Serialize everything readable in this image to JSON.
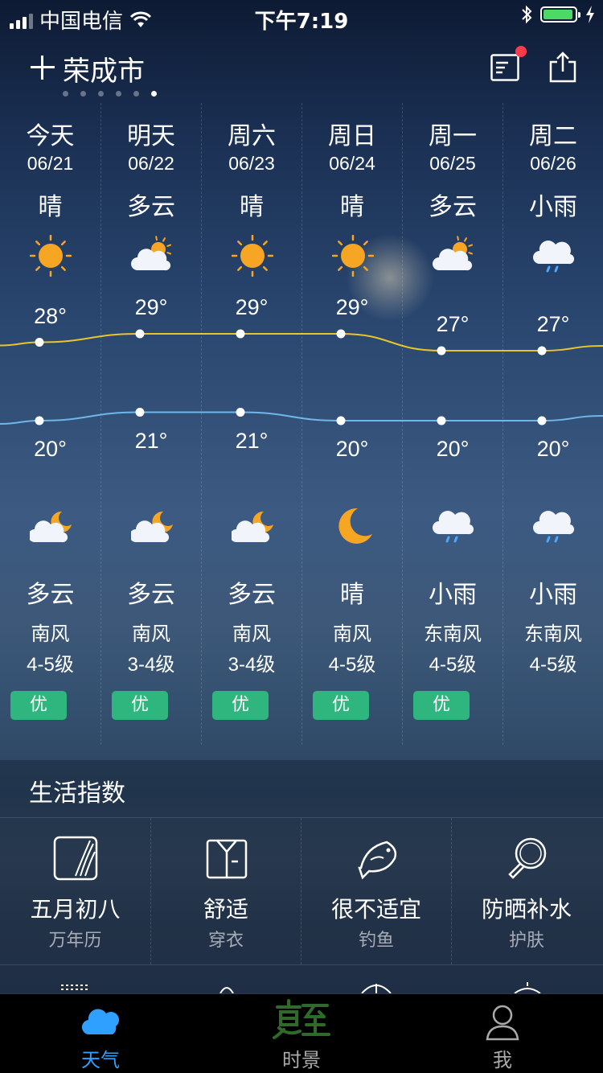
{
  "status": {
    "carrier": "中国电信",
    "time": "下午7:19"
  },
  "header": {
    "city": "荣成市",
    "page_count": 6,
    "active_page": 5
  },
  "forecast": [
    {
      "day": "今天",
      "date": "06/21",
      "day_cond": "晴",
      "day_icon": "sun-icon",
      "high": "28°",
      "low": "20°",
      "night_icon": "cloudy-moon-icon",
      "night_cond": "多云",
      "wind": "南风",
      "level": "4-5级",
      "aqi": "优"
    },
    {
      "day": "明天",
      "date": "06/22",
      "day_cond": "多云",
      "day_icon": "cloudy-sun-icon",
      "high": "29°",
      "low": "21°",
      "night_icon": "cloudy-moon-icon",
      "night_cond": "多云",
      "wind": "南风",
      "level": "3-4级",
      "aqi": "优"
    },
    {
      "day": "周六",
      "date": "06/23",
      "day_cond": "晴",
      "day_icon": "sun-icon",
      "high": "29°",
      "low": "21°",
      "night_icon": "cloudy-moon-icon",
      "night_cond": "多云",
      "wind": "南风",
      "level": "3-4级",
      "aqi": "优"
    },
    {
      "day": "周日",
      "date": "06/24",
      "day_cond": "晴",
      "day_icon": "sun-icon",
      "high": "29°",
      "low": "20°",
      "night_icon": "moon-icon",
      "night_cond": "晴",
      "wind": "南风",
      "level": "4-5级",
      "aqi": "优"
    },
    {
      "day": "周一",
      "date": "06/25",
      "day_cond": "多云",
      "day_icon": "cloudy-sun-icon",
      "high": "27°",
      "low": "20°",
      "night_icon": "rain-icon",
      "night_cond": "小雨",
      "wind": "东南风",
      "level": "4-5级",
      "aqi": "优"
    },
    {
      "day": "周二",
      "date": "06/26",
      "day_cond": "小雨",
      "day_icon": "rain-icon",
      "high": "27°",
      "low": "20°",
      "night_icon": "rain-icon",
      "night_cond": "小雨",
      "wind": "东南风",
      "level": "4-5级",
      "aqi": ""
    }
  ],
  "chart_data": {
    "type": "line",
    "categories": [
      "06/21",
      "06/22",
      "06/23",
      "06/24",
      "06/25",
      "06/26"
    ],
    "series": [
      {
        "values": [
          28,
          29,
          29,
          29,
          27,
          27
        ],
        "color": "#e8c52a"
      },
      {
        "values": [
          20,
          21,
          21,
          20,
          20,
          20
        ],
        "color": "#6fb7e8"
      }
    ]
  },
  "life": {
    "title": "生活指数",
    "items": [
      {
        "value": "五月初八",
        "label": "万年历",
        "icon": "almanac-icon"
      },
      {
        "value": "舒适",
        "label": "穿衣",
        "icon": "shirt-icon"
      },
      {
        "value": "很不适宜",
        "label": "钓鱼",
        "icon": "fish-icon"
      },
      {
        "value": "防晒补水",
        "label": "护肤",
        "icon": "magnifier-icon"
      }
    ]
  },
  "tabs": [
    {
      "label": "天气",
      "icon": "cloud-icon",
      "active": true
    },
    {
      "label": "时景",
      "icon": "xiazhi-logo",
      "active": false
    },
    {
      "label": "我",
      "icon": "person-icon",
      "active": false
    }
  ],
  "colors": {
    "aqi_good": "#2fb67e",
    "accent": "#2fa0ff",
    "high_line": "#e8c52a",
    "low_line": "#6fb7e8",
    "notify": "#ff3b4a"
  }
}
